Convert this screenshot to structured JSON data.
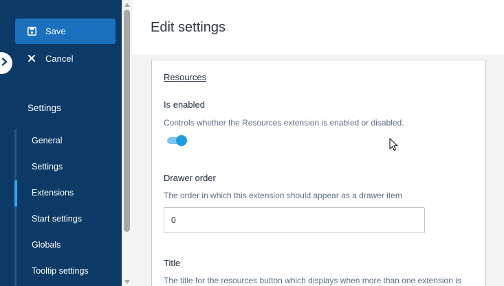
{
  "sidebar": {
    "save_label": "Save",
    "cancel_label": "Cancel",
    "section_title": "Settings",
    "items": [
      {
        "label": "General",
        "active": false
      },
      {
        "label": "Settings",
        "active": false
      },
      {
        "label": "Extensions",
        "active": true
      },
      {
        "label": "Start settings",
        "active": false
      },
      {
        "label": "Globals",
        "active": false
      },
      {
        "label": "Tooltip settings",
        "active": false
      }
    ]
  },
  "header": {
    "title": "Edit settings"
  },
  "card": {
    "title": "Resources",
    "enabled": {
      "label": "Is enabled",
      "description": "Controls whether the Resources extension is enabled or disabled.",
      "value": true
    },
    "drawer_order": {
      "label": "Drawer order",
      "description": "The order in which this extension should appear as a drawer item",
      "value": "0"
    },
    "title_field": {
      "label": "Title",
      "description": "The title for the resources button which displays when more than one extension is"
    }
  },
  "colors": {
    "sidebar_bg": "#0b3a66",
    "save_button": "#1a70bd",
    "active_indicator": "#35a7e8",
    "toggle_on": "#1e9be0"
  },
  "icons": {
    "save": "floppy-disk-icon",
    "cancel": "close-icon",
    "expand": "chevron-right-icon"
  }
}
